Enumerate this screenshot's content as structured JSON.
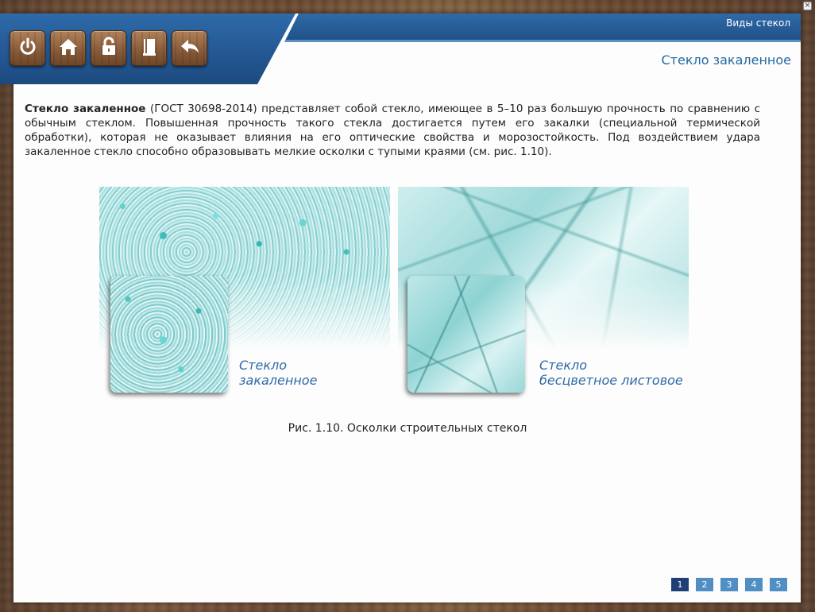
{
  "header": {
    "section_title": "Виды стекол",
    "page_title": "Стекло закаленное"
  },
  "toolbar": {
    "buttons": [
      {
        "icon": "power-icon"
      },
      {
        "icon": "home-icon"
      },
      {
        "icon": "lock-icon"
      },
      {
        "icon": "book-icon"
      },
      {
        "icon": "back-arrow-icon"
      }
    ]
  },
  "window": {
    "close_glyph": "×"
  },
  "content": {
    "term": "Стекло закаленное",
    "paragraph": " (ГОСТ 30698-2014) представляет собой стекло, имеющее в 5–10 раз большую прочность по сравнению с обычным стеклом. Повышенная прочность такого стекла достигается путем его закалки (специальной термической обработки), которая не оказывает влияния на его оптические свойства и морозостойкость. Под воздействием удара закаленное стекло способно образовывать мелкие осколки с тупыми краями (см. рис. 1.10)."
  },
  "figure": {
    "left_label_line1": "Стекло",
    "left_label_line2": "закаленное",
    "right_label_line1": "Стекло",
    "right_label_line2": "бесцветное листовое",
    "caption": "Рис. 1.10. Осколки строительных стекол"
  },
  "pager": {
    "pages": [
      "1",
      "2",
      "3",
      "4",
      "5"
    ],
    "current": "1"
  },
  "colors": {
    "header_blue": "#1f4f86",
    "title_blue": "#2468a3",
    "pager_blue": "#4f8fc4",
    "pager_active": "#1d3f73"
  }
}
